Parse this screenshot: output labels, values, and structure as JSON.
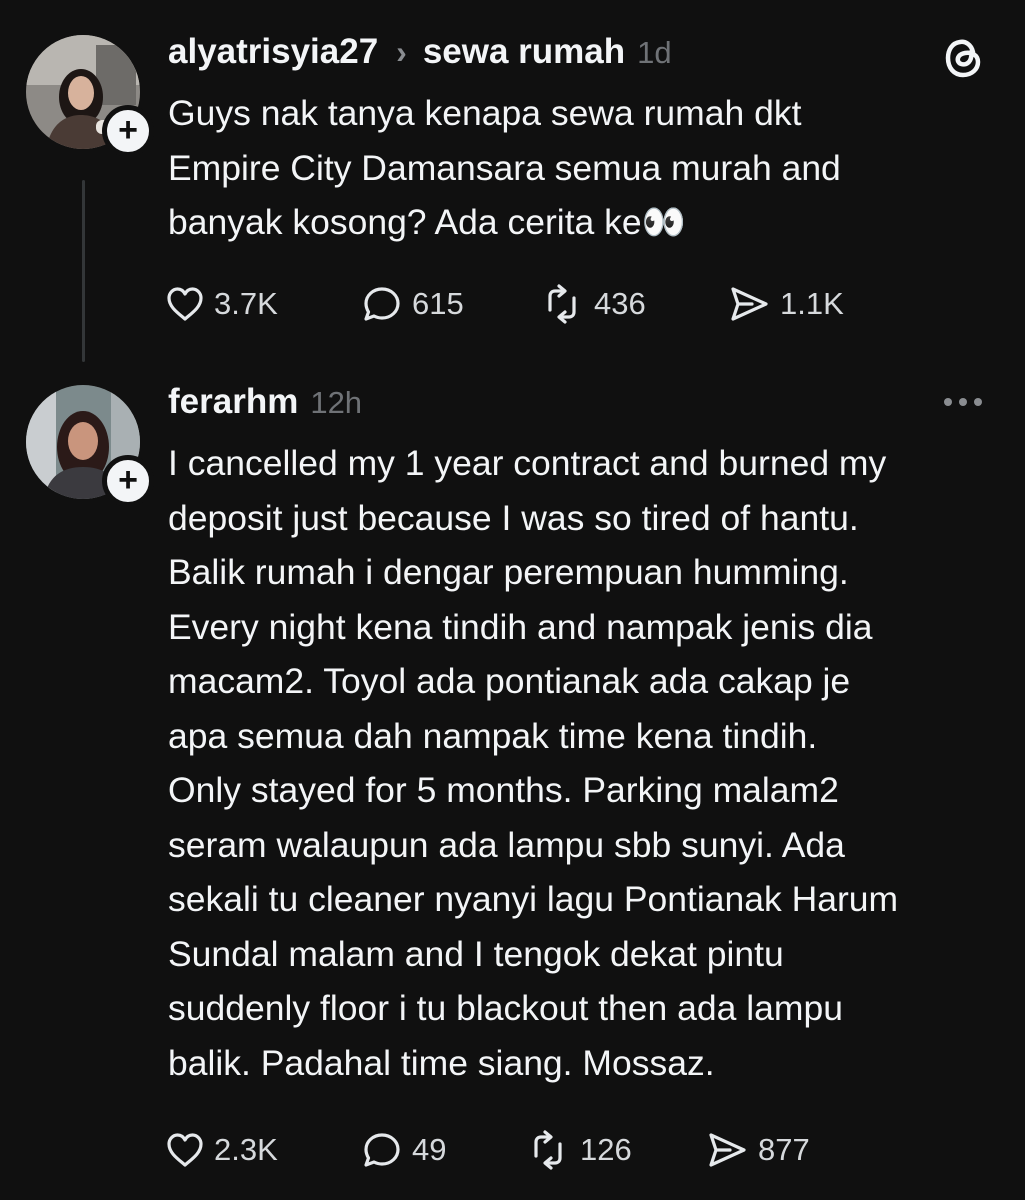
{
  "post1": {
    "username": "alyatrisyia27",
    "separator": "›",
    "topic": "sewa rumah",
    "time": "1d",
    "avatar_badge": "+",
    "text": "Guys nak tanya kenapa sewa rumah dkt\nEmpire City Damansara semua murah and\nbanyak kosong? Ada cerita ke👀",
    "likes": "3.7K",
    "replies": "615",
    "reposts": "436",
    "shares": "1.1K"
  },
  "post2": {
    "username": "ferarhm",
    "time": "12h",
    "avatar_badge": "+",
    "text": "I cancelled my 1 year contract and burned my\ndeposit just because I was so tired of hantu.\nBalik rumah i dengar perempuan humming.\nEvery night kena tindih and nampak jenis dia\nmacam2. Toyol ada pontianak ada cakap je\napa semua dah nampak time kena tindih.\nOnly stayed for 5 months. Parking malam2\nseram walaupun ada lampu sbb sunyi. Ada\nsekali tu cleaner nyanyi lagu Pontianak Harum\nSundal malam and I tengok dekat pintu\nsuddenly floor i tu blackout then ada lampu\nbalik. Padahal time siang. Mossaz.",
    "likes": "2.3K",
    "replies": "49",
    "reposts": "126",
    "shares": "877"
  },
  "icons": {
    "app_logo": "threads-logo-icon",
    "more": "more-horizontal-icon",
    "like": "heart-icon",
    "reply": "comment-bubble-icon",
    "repost": "repost-arrows-icon",
    "share": "send-paper-plane-icon"
  },
  "colors": {
    "background": "#101010",
    "text": "#f3f5f7",
    "muted": "#6f7276",
    "thread_line": "#333638"
  }
}
